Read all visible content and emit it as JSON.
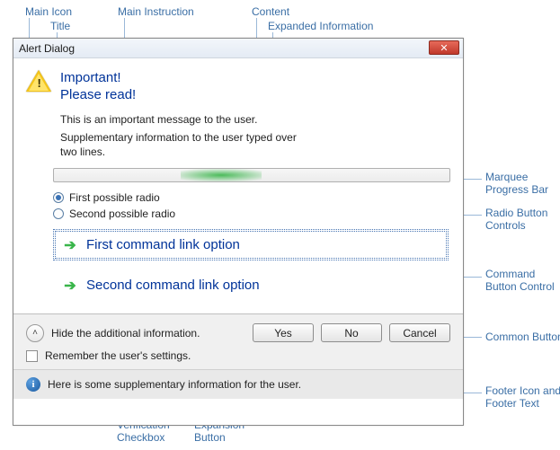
{
  "callouts": {
    "main_icon": "Main Icon",
    "title": "Title",
    "main_instruction": "Main Instruction",
    "content": "Content",
    "expanded_information": "Expanded Information",
    "marquee_progress_bar": "Marquee\nProgress Bar",
    "radio_button_controls": "Radio Button\nControls",
    "command_button_control": "Command\nButton Control",
    "common_buttons": "Common Buttons",
    "footer_icon_text": "Footer Icon and\nFooter Text",
    "verification_checkbox": "Verification\nCheckbox",
    "expansion_button": "Expansion\nButton"
  },
  "dialog": {
    "title": "Alert Dialog",
    "main_instruction_line1": "Important!",
    "main_instruction_line2": "Please read!",
    "content_text": "This is an important message to the user.",
    "expanded_text": "Supplementary information to the user typed over two lines.",
    "radios": [
      {
        "label": "First possible radio",
        "checked": true
      },
      {
        "label": "Second possible radio",
        "checked": false
      }
    ],
    "command_links": [
      "First command link option",
      "Second command link option"
    ],
    "expand_collapse_label": "Hide the additional information.",
    "verification_label": "Remember the user's settings.",
    "buttons": {
      "yes": "Yes",
      "no": "No",
      "cancel": "Cancel"
    },
    "footer_text": "Here is some supplementary information for the user."
  }
}
